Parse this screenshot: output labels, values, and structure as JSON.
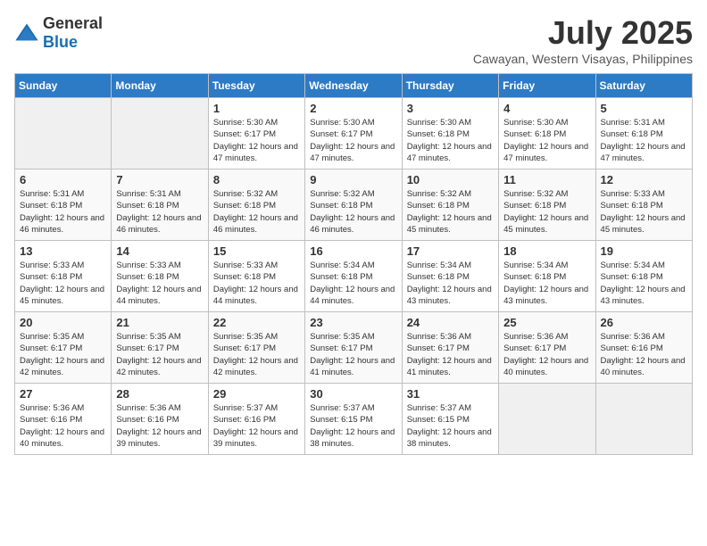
{
  "logo": {
    "text_general": "General",
    "text_blue": "Blue"
  },
  "title": "July 2025",
  "location": "Cawayan, Western Visayas, Philippines",
  "days_of_week": [
    "Sunday",
    "Monday",
    "Tuesday",
    "Wednesday",
    "Thursday",
    "Friday",
    "Saturday"
  ],
  "weeks": [
    [
      {
        "day": "",
        "info": ""
      },
      {
        "day": "",
        "info": ""
      },
      {
        "day": "1",
        "info": "Sunrise: 5:30 AM\nSunset: 6:17 PM\nDaylight: 12 hours and 47 minutes."
      },
      {
        "day": "2",
        "info": "Sunrise: 5:30 AM\nSunset: 6:17 PM\nDaylight: 12 hours and 47 minutes."
      },
      {
        "day": "3",
        "info": "Sunrise: 5:30 AM\nSunset: 6:18 PM\nDaylight: 12 hours and 47 minutes."
      },
      {
        "day": "4",
        "info": "Sunrise: 5:30 AM\nSunset: 6:18 PM\nDaylight: 12 hours and 47 minutes."
      },
      {
        "day": "5",
        "info": "Sunrise: 5:31 AM\nSunset: 6:18 PM\nDaylight: 12 hours and 47 minutes."
      }
    ],
    [
      {
        "day": "6",
        "info": "Sunrise: 5:31 AM\nSunset: 6:18 PM\nDaylight: 12 hours and 46 minutes."
      },
      {
        "day": "7",
        "info": "Sunrise: 5:31 AM\nSunset: 6:18 PM\nDaylight: 12 hours and 46 minutes."
      },
      {
        "day": "8",
        "info": "Sunrise: 5:32 AM\nSunset: 6:18 PM\nDaylight: 12 hours and 46 minutes."
      },
      {
        "day": "9",
        "info": "Sunrise: 5:32 AM\nSunset: 6:18 PM\nDaylight: 12 hours and 46 minutes."
      },
      {
        "day": "10",
        "info": "Sunrise: 5:32 AM\nSunset: 6:18 PM\nDaylight: 12 hours and 45 minutes."
      },
      {
        "day": "11",
        "info": "Sunrise: 5:32 AM\nSunset: 6:18 PM\nDaylight: 12 hours and 45 minutes."
      },
      {
        "day": "12",
        "info": "Sunrise: 5:33 AM\nSunset: 6:18 PM\nDaylight: 12 hours and 45 minutes."
      }
    ],
    [
      {
        "day": "13",
        "info": "Sunrise: 5:33 AM\nSunset: 6:18 PM\nDaylight: 12 hours and 45 minutes."
      },
      {
        "day": "14",
        "info": "Sunrise: 5:33 AM\nSunset: 6:18 PM\nDaylight: 12 hours and 44 minutes."
      },
      {
        "day": "15",
        "info": "Sunrise: 5:33 AM\nSunset: 6:18 PM\nDaylight: 12 hours and 44 minutes."
      },
      {
        "day": "16",
        "info": "Sunrise: 5:34 AM\nSunset: 6:18 PM\nDaylight: 12 hours and 44 minutes."
      },
      {
        "day": "17",
        "info": "Sunrise: 5:34 AM\nSunset: 6:18 PM\nDaylight: 12 hours and 43 minutes."
      },
      {
        "day": "18",
        "info": "Sunrise: 5:34 AM\nSunset: 6:18 PM\nDaylight: 12 hours and 43 minutes."
      },
      {
        "day": "19",
        "info": "Sunrise: 5:34 AM\nSunset: 6:18 PM\nDaylight: 12 hours and 43 minutes."
      }
    ],
    [
      {
        "day": "20",
        "info": "Sunrise: 5:35 AM\nSunset: 6:17 PM\nDaylight: 12 hours and 42 minutes."
      },
      {
        "day": "21",
        "info": "Sunrise: 5:35 AM\nSunset: 6:17 PM\nDaylight: 12 hours and 42 minutes."
      },
      {
        "day": "22",
        "info": "Sunrise: 5:35 AM\nSunset: 6:17 PM\nDaylight: 12 hours and 42 minutes."
      },
      {
        "day": "23",
        "info": "Sunrise: 5:35 AM\nSunset: 6:17 PM\nDaylight: 12 hours and 41 minutes."
      },
      {
        "day": "24",
        "info": "Sunrise: 5:36 AM\nSunset: 6:17 PM\nDaylight: 12 hours and 41 minutes."
      },
      {
        "day": "25",
        "info": "Sunrise: 5:36 AM\nSunset: 6:17 PM\nDaylight: 12 hours and 40 minutes."
      },
      {
        "day": "26",
        "info": "Sunrise: 5:36 AM\nSunset: 6:16 PM\nDaylight: 12 hours and 40 minutes."
      }
    ],
    [
      {
        "day": "27",
        "info": "Sunrise: 5:36 AM\nSunset: 6:16 PM\nDaylight: 12 hours and 40 minutes."
      },
      {
        "day": "28",
        "info": "Sunrise: 5:36 AM\nSunset: 6:16 PM\nDaylight: 12 hours and 39 minutes."
      },
      {
        "day": "29",
        "info": "Sunrise: 5:37 AM\nSunset: 6:16 PM\nDaylight: 12 hours and 39 minutes."
      },
      {
        "day": "30",
        "info": "Sunrise: 5:37 AM\nSunset: 6:15 PM\nDaylight: 12 hours and 38 minutes."
      },
      {
        "day": "31",
        "info": "Sunrise: 5:37 AM\nSunset: 6:15 PM\nDaylight: 12 hours and 38 minutes."
      },
      {
        "day": "",
        "info": ""
      },
      {
        "day": "",
        "info": ""
      }
    ]
  ]
}
